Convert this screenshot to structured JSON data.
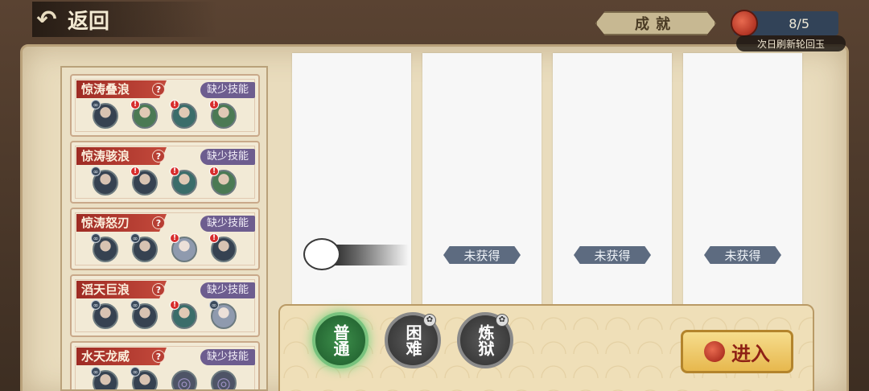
{
  "header": {
    "back_label": "返回",
    "achievement_label": "成就",
    "jade_count": "8/5",
    "refresh_note": "次日刷新轮回玉"
  },
  "stages": [
    {
      "name": "惊涛叠浪",
      "tag": "缺少技能",
      "heroes": [
        {
          "style": "dark",
          "badge": "link"
        },
        {
          "style": "green",
          "badge": "warn"
        },
        {
          "style": "teal",
          "badge": "warn"
        },
        {
          "style": "green",
          "badge": "warn"
        }
      ]
    },
    {
      "name": "惊涛骇浪",
      "tag": "缺少技能",
      "heroes": [
        {
          "style": "dark",
          "badge": "link"
        },
        {
          "style": "dark",
          "badge": "warn"
        },
        {
          "style": "teal",
          "badge": "warn"
        },
        {
          "style": "green",
          "badge": "warn"
        }
      ]
    },
    {
      "name": "惊涛怒刃",
      "tag": "缺少技能",
      "heroes": [
        {
          "style": "dark",
          "badge": "link"
        },
        {
          "style": "dark",
          "badge": "link"
        },
        {
          "style": "light",
          "badge": "warn"
        },
        {
          "style": "dark",
          "badge": "warn"
        }
      ]
    },
    {
      "name": "滔天巨浪",
      "tag": "缺少技能",
      "heroes": [
        {
          "style": "dark",
          "badge": "link"
        },
        {
          "style": "dark",
          "badge": "link"
        },
        {
          "style": "teal",
          "badge": "warn"
        },
        {
          "style": "light",
          "badge": "link"
        }
      ]
    },
    {
      "name": "水天龙威",
      "tag": "缺少技能",
      "heroes": [
        {
          "style": "dark",
          "badge": "link"
        },
        {
          "style": "dark",
          "badge": "link"
        },
        {
          "style": "empty",
          "badge": ""
        },
        {
          "style": "empty",
          "badge": ""
        }
      ]
    }
  ],
  "rewards": [
    {
      "status": ""
    },
    {
      "status": "未获得"
    },
    {
      "status": "未获得"
    },
    {
      "status": "未获得"
    }
  ],
  "difficulty": {
    "normal": "普通",
    "hard": "困难",
    "purgatory": "炼狱"
  },
  "enter_label": "进入",
  "icons": {
    "back": "back-arrow-icon",
    "jade": "jade-orb-icon",
    "help": "help-icon",
    "warn": "warning-icon",
    "link": "link-icon",
    "lock": "lock-icon"
  }
}
